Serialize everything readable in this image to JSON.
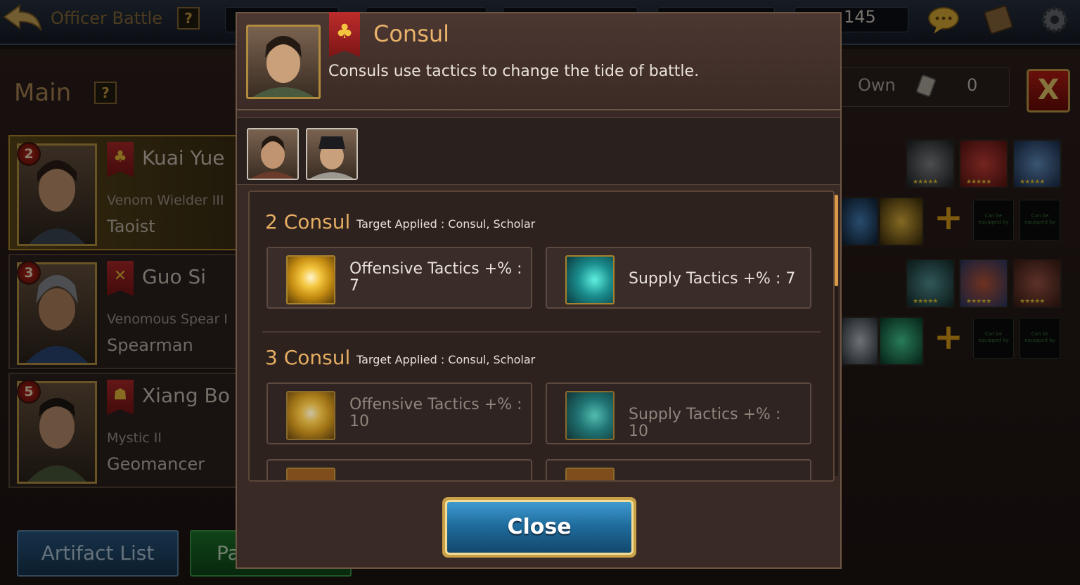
{
  "topbar": {
    "title": "Officer Battle",
    "help": "?",
    "resource_value": "145"
  },
  "main": {
    "title": "Main",
    "help": "?",
    "own_label": "Own",
    "own_value": "0",
    "close_symbol": "X"
  },
  "officers": [
    {
      "rank": "2",
      "name": "Kuai Yue",
      "subtitle": "Venom Wielder III",
      "role": "Taoist",
      "banner_icon": "tree-emblem"
    },
    {
      "rank": "3",
      "name": "Guo Si",
      "subtitle": "Venomous Spear I",
      "role": "Spearman",
      "banner_icon": "crossed-spears-emblem"
    },
    {
      "rank": "5",
      "name": "Xiang Bo",
      "subtitle": "Mystic II",
      "role": "Geomancer",
      "banner_icon": "hat-emblem"
    }
  ],
  "equipment": {
    "stars": "★★★★★",
    "plus": "+",
    "empty_slot_text": "Can be equipped by"
  },
  "bottom_buttons": {
    "artifact_list": "Artifact List",
    "second": "Pa"
  },
  "modal": {
    "title": "Consul",
    "description": "Consuls use tactics to change the tide of battle.",
    "banner_icon": "tree-emblem",
    "sections": [
      {
        "title": "2 Consul",
        "target": "Target Applied : Consul, Scholar",
        "effects": [
          {
            "label": "Offensive Tactics +% : 7",
            "icon": "lotus-icon"
          },
          {
            "label": "Supply Tactics +% : 7",
            "icon": "claw-icon"
          }
        ]
      },
      {
        "title": "3 Consul",
        "target": "Target Applied : Consul, Scholar",
        "effects": [
          {
            "label": "Offensive Tactics +% : 10",
            "icon": "lotus-icon"
          },
          {
            "label": "Supply Tactics +% : 10",
            "icon": "claw-icon"
          }
        ]
      }
    ],
    "close_label": "Close"
  },
  "colors": {
    "accent_gold": "#e6ae62",
    "close_blue": "#1f6d9e",
    "panel_brown": "#3a2a26"
  }
}
